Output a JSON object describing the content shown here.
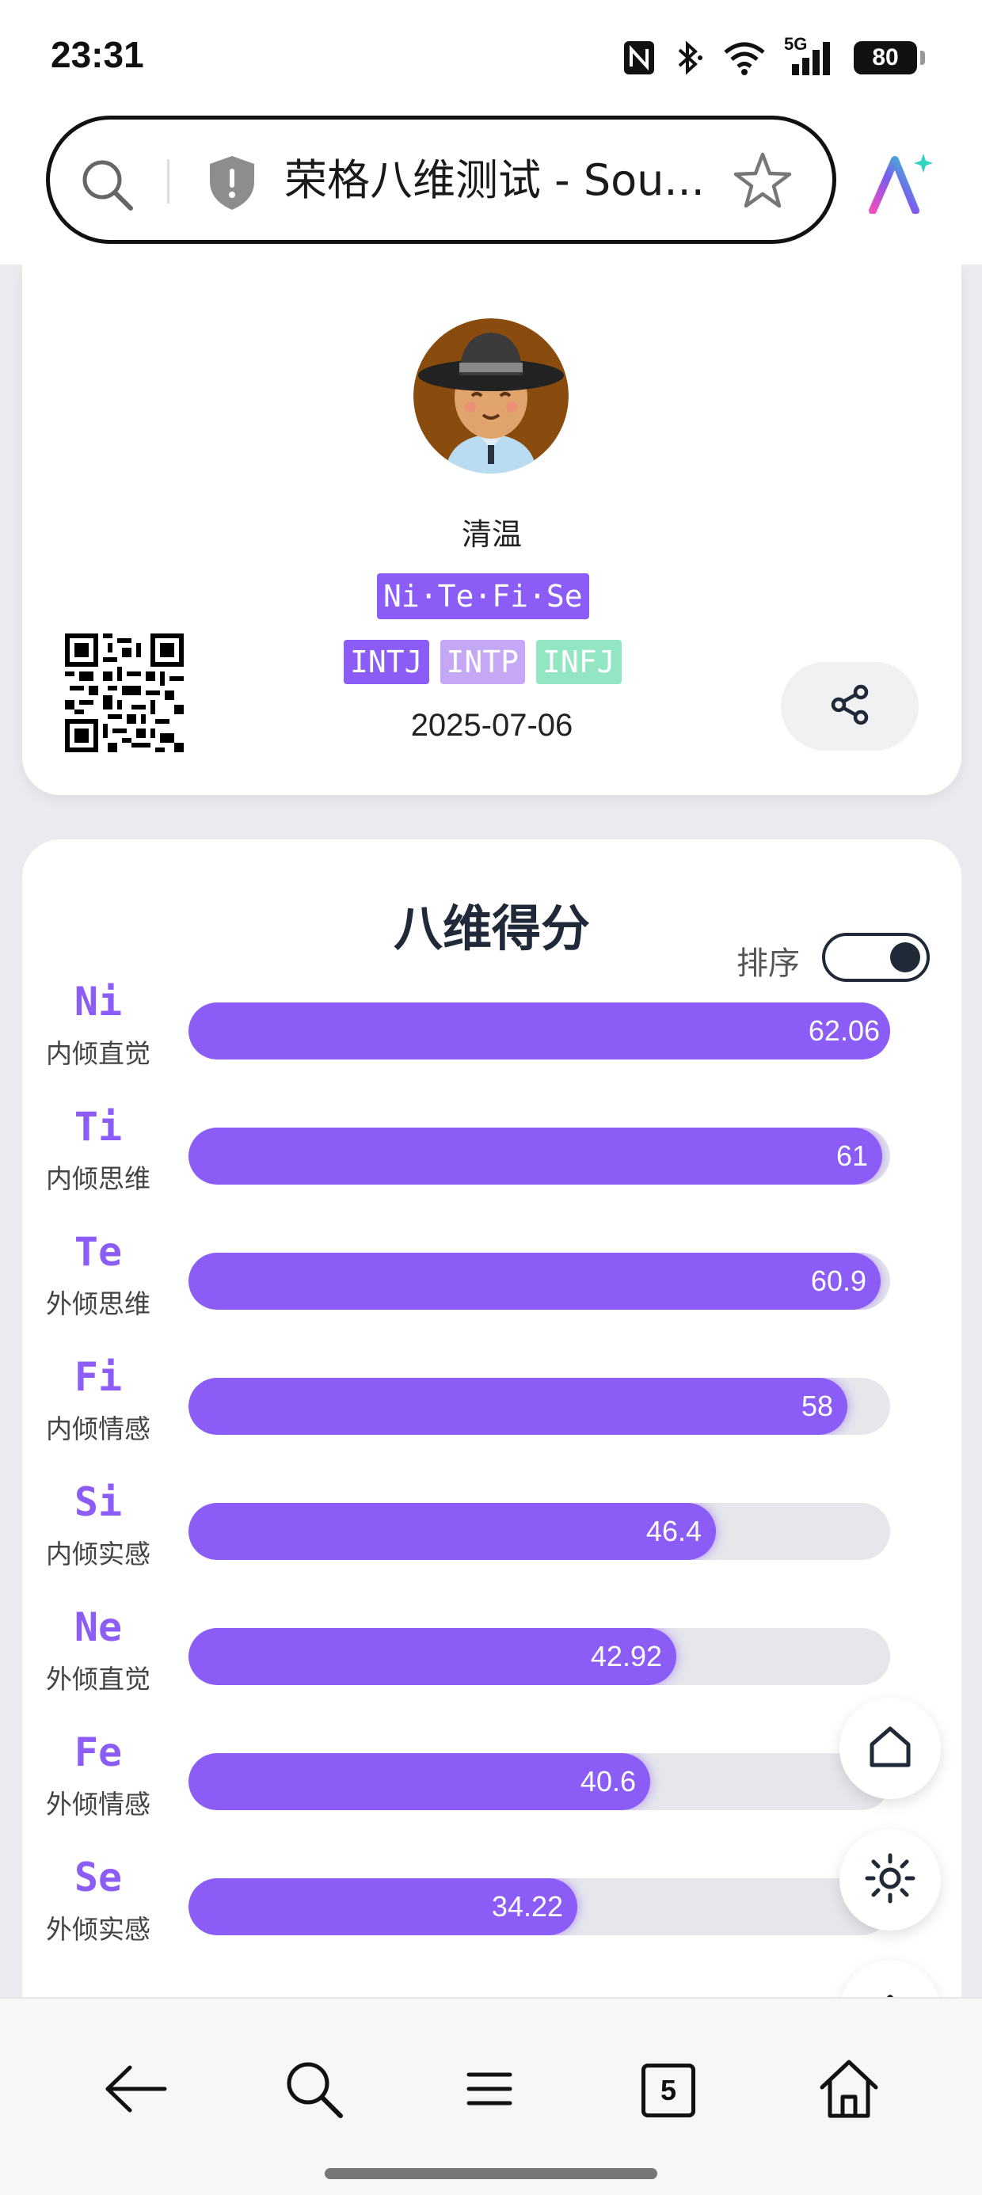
{
  "status_bar": {
    "time": "23:31",
    "network": "5G",
    "battery": "80",
    "icons": [
      "nfc-icon",
      "bluetooth-icon",
      "wifi-icon",
      "signal-icon",
      "battery-icon"
    ]
  },
  "address_bar": {
    "title": "荣格八维测试 - Sou...",
    "icons": [
      "search-icon",
      "shield-icon",
      "star-icon",
      "ai-assistant-icon"
    ]
  },
  "profile": {
    "name": "清温",
    "functions": "Ni·Te·Fi·Se",
    "types": [
      {
        "label": "INTJ",
        "color": "#8b5cf6"
      },
      {
        "label": "INTP",
        "color": "#c4a8f5"
      },
      {
        "label": "INFJ",
        "color": "#93e6c4"
      }
    ],
    "date": "2025-07-06"
  },
  "scores": {
    "title": "八维得分",
    "sort_label": "排序",
    "sort_enabled": true,
    "items": [
      {
        "code": "Ni",
        "name": "内倾直觉",
        "value": "62.06",
        "percent": 62.06
      },
      {
        "code": "Ti",
        "name": "内倾思维",
        "value": "61",
        "percent": 61
      },
      {
        "code": "Te",
        "name": "外倾思维",
        "value": "60.9",
        "percent": 60.9
      },
      {
        "code": "Fi",
        "name": "内倾情感",
        "value": "58",
        "percent": 58
      },
      {
        "code": "Si",
        "name": "内倾实感",
        "value": "46.4",
        "percent": 46.4
      },
      {
        "code": "Ne",
        "name": "外倾直觉",
        "value": "42.92",
        "percent": 42.92
      },
      {
        "code": "Fe",
        "name": "外倾情感",
        "value": "40.6",
        "percent": 40.6
      },
      {
        "code": "Se",
        "name": "外倾实感",
        "value": "34.22",
        "percent": 34.22
      }
    ]
  },
  "bottom_nav": {
    "tabs_count": "5"
  },
  "colors": {
    "accent": "#8b5cf6",
    "text_dark": "#1f2937"
  }
}
